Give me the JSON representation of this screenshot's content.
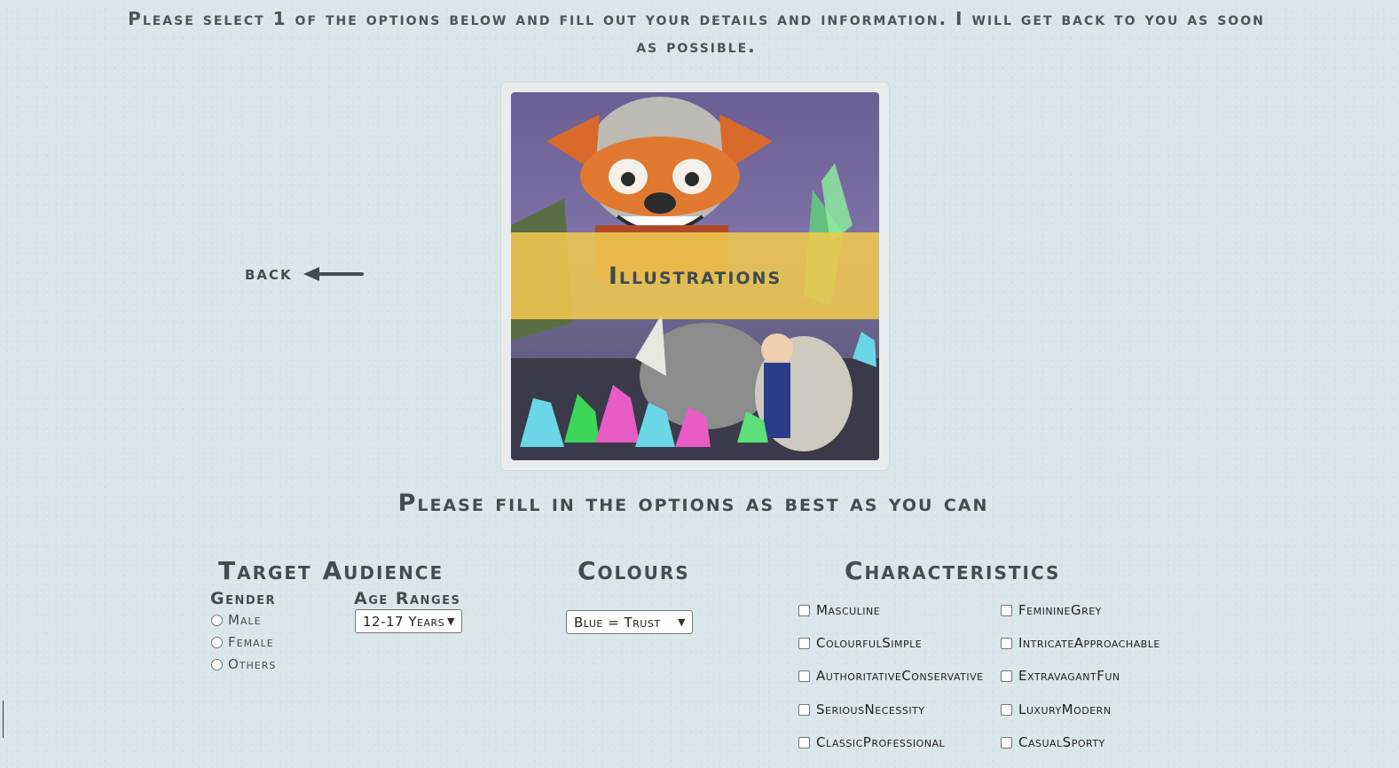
{
  "intro": "Please select 1 of the options below and fill out your details and information. I will get back to you as soon as possible.",
  "back": {
    "label": "back",
    "icon": "arrow-left-icon"
  },
  "card": {
    "label": "Illustrations",
    "image": "illustration-artwork"
  },
  "subtitle": "Please fill in the options as best as you can",
  "target_audience": {
    "heading": "Target Audience",
    "gender": {
      "label": "Gender",
      "options": [
        "Male",
        "Female",
        "Others"
      ]
    },
    "age": {
      "label": "Age Ranges",
      "selected": "12-17 Years"
    }
  },
  "colours": {
    "heading": "Colours",
    "selected": "Blue = Trust"
  },
  "characteristics": {
    "heading": "Characteristics",
    "left": [
      "Masculine",
      "ColourfulSimple",
      "AuthoritativeConservative",
      "SeriousNecessity",
      "ClassicProfessional"
    ],
    "right": [
      "FeminineGrey",
      "IntricateApproachable",
      "ExtravagantFun",
      "LuxuryModern",
      "CasualSporty"
    ]
  },
  "colors": {
    "background": "#d9e6ea",
    "banner": "#f0c850",
    "text": "#3f4e55"
  }
}
